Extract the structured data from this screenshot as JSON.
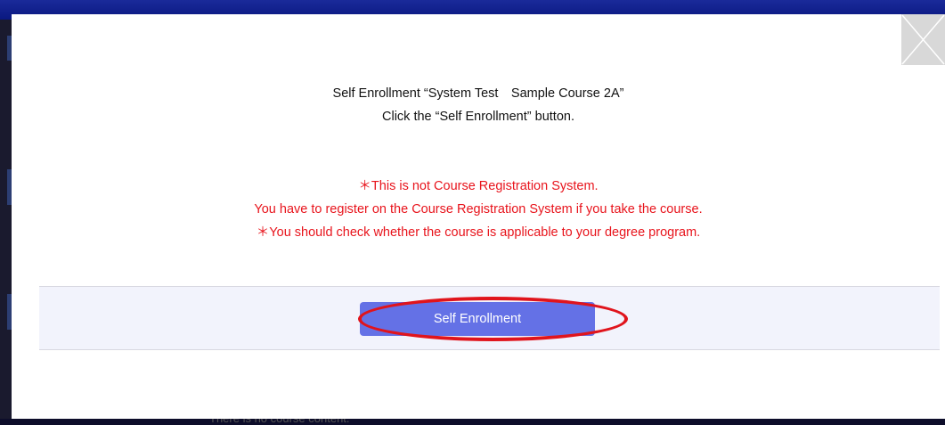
{
  "modal": {
    "message_line1": "Self Enrollment “System Test　Sample Course 2A”",
    "message_line2": "Click the “Self Enrollment” button.",
    "warning_line1": "＊This is not Course Registration System.",
    "warning_line2": "You have to register on the Course Registration System if you take the course.",
    "warning_line3": "＊You should check whether the course is applicable to your degree program.",
    "enroll_button_label": "Self Enrollment",
    "close_icon": "close-icon"
  },
  "background": {
    "partial_text": "There is no course content."
  },
  "colors": {
    "warning": "#e8141c",
    "button": "#6471e6",
    "highlight": "#e0141c",
    "footer_bg": "#f2f3fc"
  }
}
